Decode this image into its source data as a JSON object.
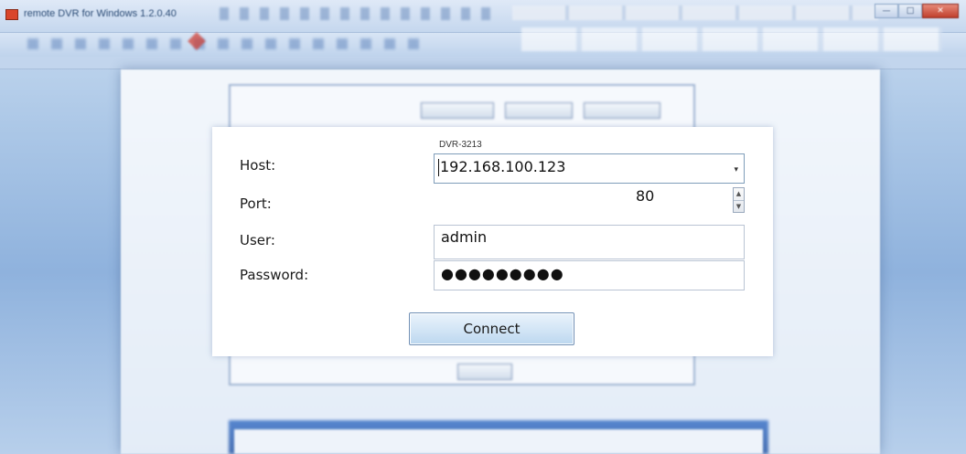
{
  "window": {
    "title": "remote DVR for Windows 1.2.0.40",
    "min_glyph": "—",
    "max_glyph": "□",
    "close_glyph": "✕"
  },
  "dialog": {
    "device_name": "DVR-3213",
    "labels": {
      "host": "Host:",
      "port": "Port:",
      "user": "User:",
      "password": "Password:"
    },
    "host_value": "192.168.100.123",
    "port_value": "80",
    "user_value": "admin",
    "password_mask": "●●●●●●●●●",
    "connect_label": "Connect",
    "dropdown_glyph": "▾",
    "spin_up_glyph": "▲",
    "spin_down_glyph": "▼"
  },
  "colors": {
    "background": "#aac6e6",
    "dialog_bg": "#ffffff",
    "button_gradient_top": "#eaf3fb",
    "button_gradient_bottom": "#bcd7ef",
    "close_button": "#c0402c"
  },
  "icons": {
    "app": "dvr-app-icon",
    "dropdown": "chevron-down-icon",
    "spin_up": "chevron-up-icon",
    "spin_down": "chevron-down-icon"
  }
}
